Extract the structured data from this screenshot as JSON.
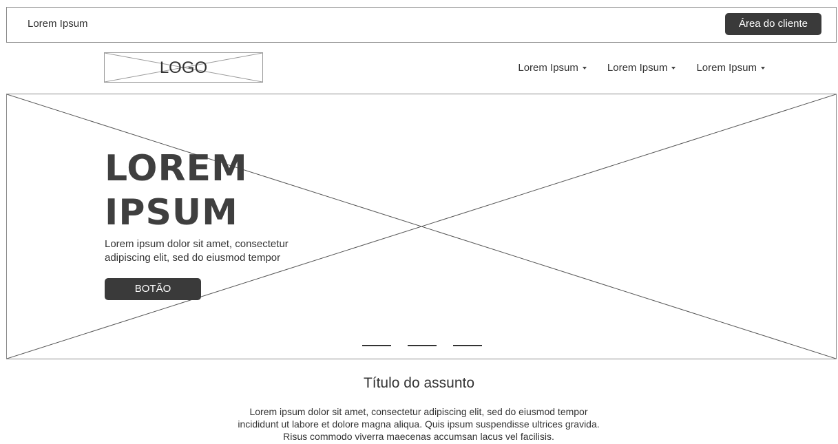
{
  "topbar": {
    "text": "Lorem Ipsum",
    "client_button": "Área do cliente"
  },
  "header": {
    "logo_text": "LOGO",
    "nav": [
      {
        "label": "Lorem Ipsum"
      },
      {
        "label": "Lorem Ipsum"
      },
      {
        "label": "Lorem Ipsum"
      }
    ]
  },
  "hero": {
    "title_line1": "LOREM",
    "title_line2": "IPSUM",
    "text_line1": "Lorem ipsum dolor sit amet, consectetur",
    "text_line2": "adipiscing elit, sed do eiusmod tempor",
    "button": "BOTÃO"
  },
  "section": {
    "title": "Título do assunto",
    "line1": "Lorem ipsum dolor sit amet, consectetur adipiscing elit, sed do eiusmod tempor",
    "line2": "incididunt ut labore et dolore magna aliqua. Quis ipsum suspendisse ultrices gravida.",
    "line3": "Risus commodo viverra maecenas accumsan lacus vel facilisis."
  },
  "icons": {
    "nav_caret": "chevron-down-icon",
    "placeholder": "image-placeholder-icon"
  }
}
